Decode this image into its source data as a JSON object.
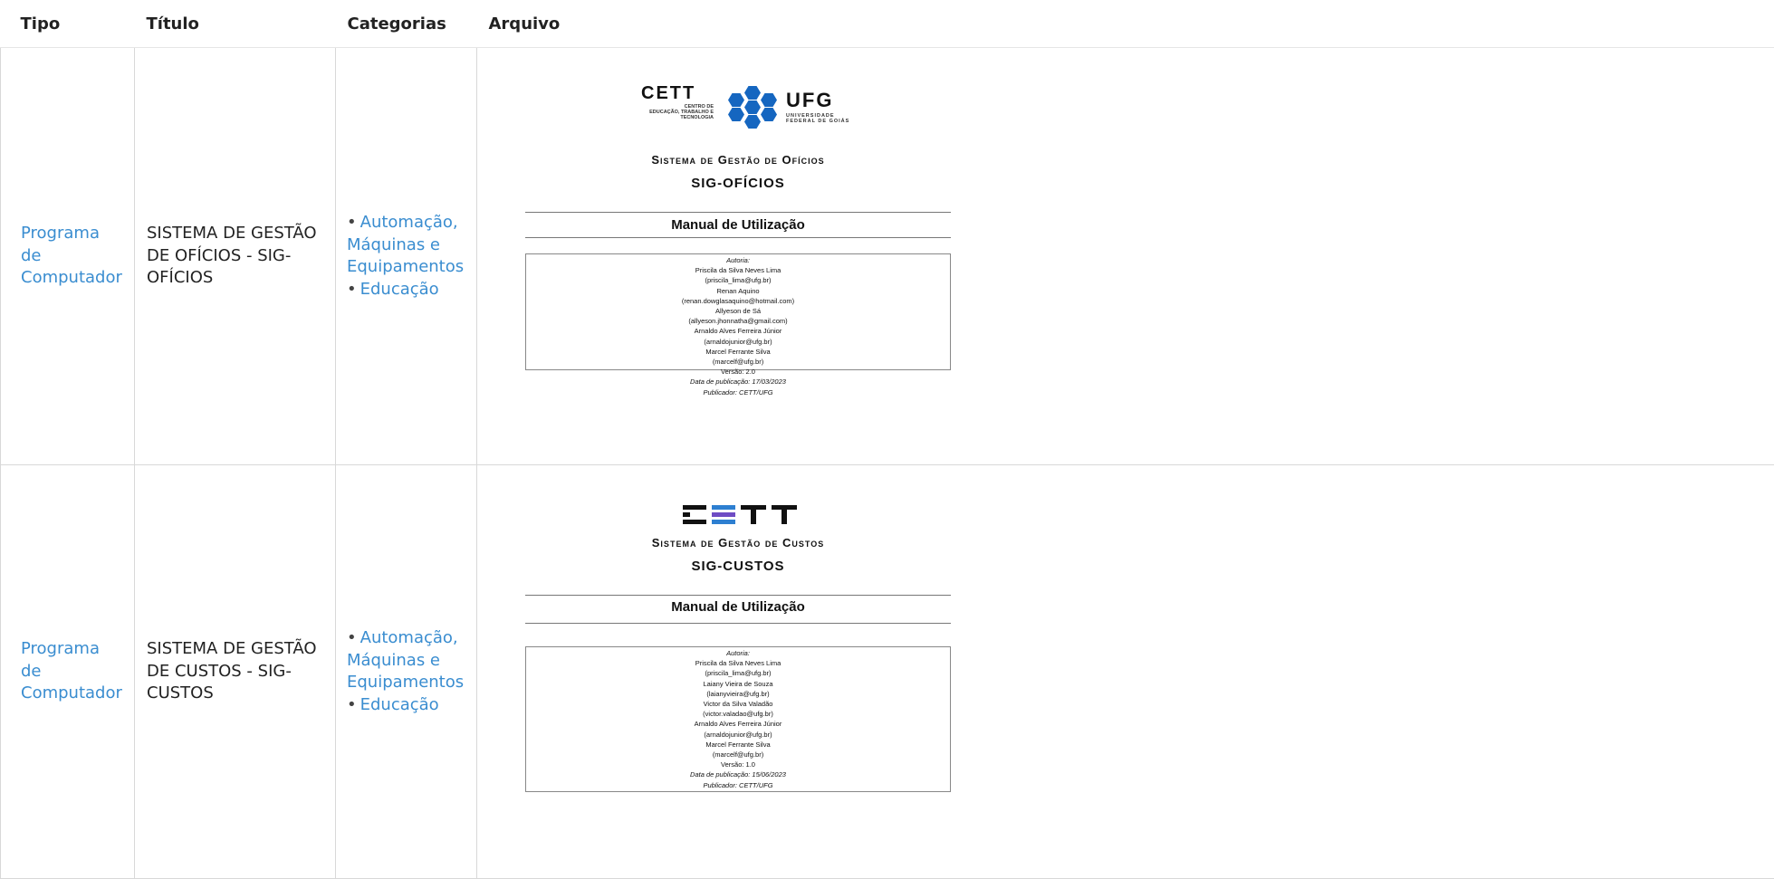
{
  "headers": {
    "tipo": "Tipo",
    "titulo": "Título",
    "categorias": "Categorias",
    "arquivo": "Arquivo"
  },
  "rows": [
    {
      "tipo": [
        "Programa",
        "de",
        "Computador"
      ],
      "titulo": "SISTEMA DE GESTÃO DE OFÍCIOS - SIG-OFÍCIOS",
      "categorias": [
        "Automação, Máquinas e Equipamentos",
        "Educação"
      ],
      "doc": {
        "cett_logo": "CETT",
        "cett_subtitle": [
          "CENTRO DE",
          "EDUCAÇÃO, TRABALHO E",
          "TECNOLOGIA"
        ],
        "ufg_logo": "UFG",
        "ufg_subtitle": [
          "UNIVERSIDADE",
          "FEDERAL DE GOIÁS"
        ],
        "system_title": "Sistema de Gestão de Ofícios",
        "system_code": "SIG-OFÍCIOS",
        "manual": "Manual de Utilização",
        "authors_label": "Autoria:",
        "authors": [
          "Priscila da Silva Neves Lima",
          "(priscila_lima@ufg.br)",
          "Renan Aquino",
          "(renan.dowglasaquino@hotmail.com)",
          "Allyeson de Sá",
          "(allyeson.jhonnatha@gmail.com)",
          "Arnaldo Alves Ferreira Júnior",
          "(arnaldojunior@ufg.br)",
          "Marcel Ferrante Silva",
          "(marcelf@ufg.br)"
        ],
        "version": "Versão: 2.0",
        "publication_date": "Data de publicação: 17/03/2023",
        "publisher": "Publicador: CETT/UFG"
      }
    },
    {
      "tipo": [
        "Programa",
        "de",
        "Computador"
      ],
      "titulo": "SISTEMA DE GESTÃO DE CUSTOS - SIG-CUSTOS",
      "categorias": [
        "Automação, Máquinas e Equipamentos",
        "Educação"
      ],
      "doc": {
        "cett_logo": "CETT",
        "system_title": "Sistema de Gestão de Custos",
        "system_code": "SIG-CUSTOS",
        "manual": "Manual de Utilização",
        "authors_label": "Autoria:",
        "authors": [
          "Priscila da Silva Neves Lima",
          "(priscila_lima@ufg.br)",
          "Laiany Vieira de Souza",
          "(laianyvieira@ufg.br)",
          "Victor da Silva Valadão",
          "(victor.valadao@ufg.br)",
          "Arnaldo Alves Ferreira Júnior",
          "(arnaldojunior@ufg.br)",
          "Marcel Ferrante Silva",
          "(marcelf@ufg.br)"
        ],
        "version": "Versão: 1.0",
        "publication_date": "Data de publicação: 15/06/2023",
        "publisher": "Publicador: CETT/UFG"
      }
    }
  ],
  "colors": {
    "link": "#3a8dd0",
    "hex_blue": "#1566c0",
    "border": "#d8d8d8"
  }
}
